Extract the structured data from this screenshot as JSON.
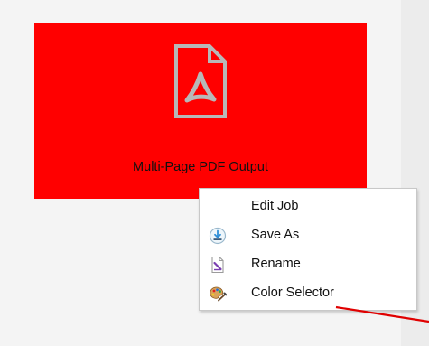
{
  "job_tile": {
    "label": "Multi-Page PDF Output",
    "color": "#ff0000",
    "icon": "pdf-file-icon"
  },
  "context_menu": {
    "items": [
      {
        "label": "Edit Job",
        "icon": ""
      },
      {
        "label": "Save As",
        "icon": "save-download-icon"
      },
      {
        "label": "Rename",
        "icon": "rename-document-icon"
      },
      {
        "label": "Color Selector",
        "icon": "palette-icon"
      }
    ]
  },
  "annotation": {
    "color": "#e00000"
  }
}
